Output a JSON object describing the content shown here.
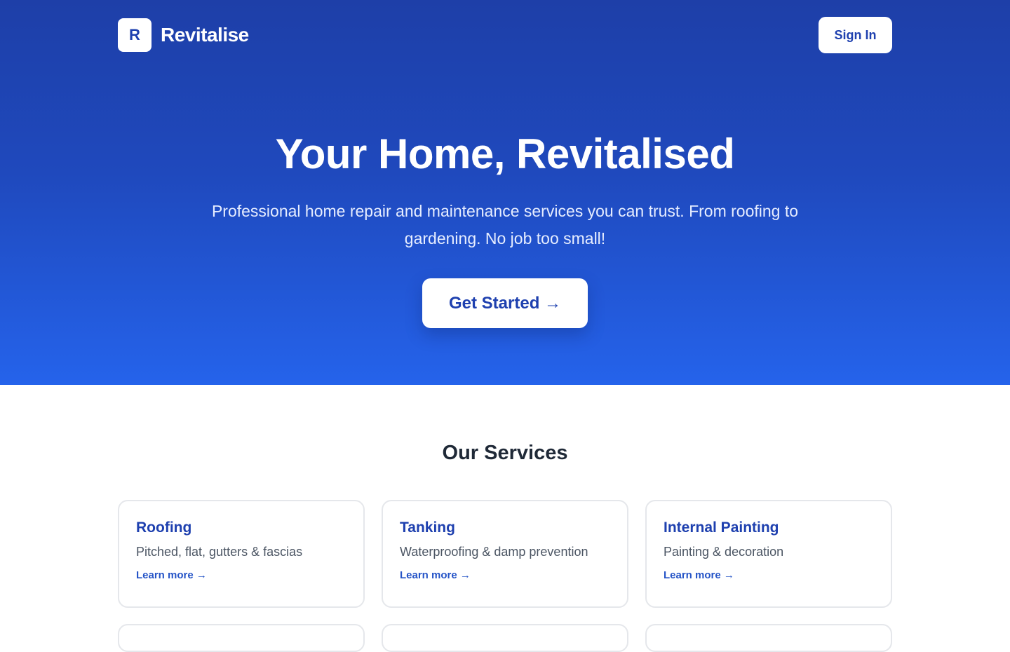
{
  "brand": {
    "logo_letter": "R",
    "name": "Revitalise"
  },
  "nav": {
    "signin_label": "Sign In"
  },
  "hero": {
    "title": "Your Home, Revitalised",
    "subtitle": "Professional home repair and maintenance services you can trust. From roofing to gardening. No job too small!",
    "cta_label": "Get Started →"
  },
  "services": {
    "heading": "Our Services",
    "items": [
      {
        "title": "Roofing",
        "description": "Pitched, flat, gutters & fascias",
        "link": "Learn more →"
      },
      {
        "title": "Tanking",
        "description": "Waterproofing & damp prevention",
        "link": "Learn more →"
      },
      {
        "title": "Internal Painting",
        "description": "Painting & decoration",
        "link": "Learn more →"
      }
    ]
  },
  "colors": {
    "hero_top": "#1e3fa8",
    "hero_bottom": "#2563eb",
    "accent": "#1e40af",
    "link": "#2554c7",
    "heading": "#1f2937",
    "card_border": "#e5e7eb"
  }
}
